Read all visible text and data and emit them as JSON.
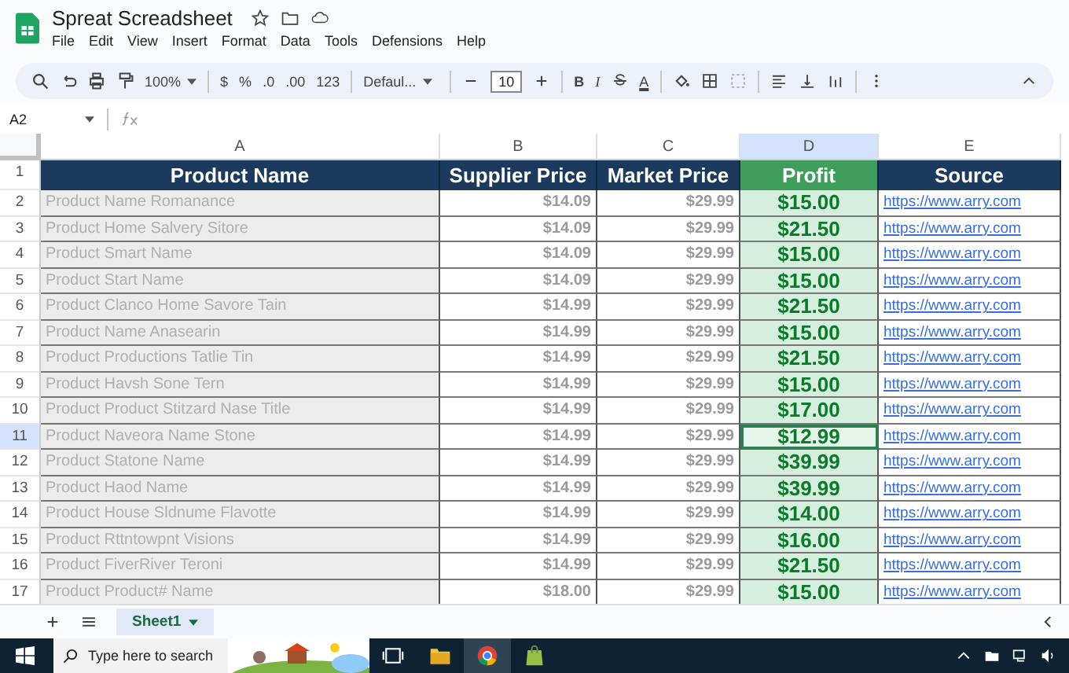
{
  "app": {
    "title": "Spreat Screadsheet",
    "menu": [
      "File",
      "Edit",
      "View",
      "Insert",
      "Format",
      "Data",
      "Tools",
      "Defensions",
      "Help"
    ]
  },
  "toolbar": {
    "zoom": "100%",
    "currency": "$",
    "percent": "%",
    "decrease_decimal": ".0",
    "increase_decimal": ".00",
    "number_format": "123",
    "font": "Defaul...",
    "font_size": "10",
    "bold": "B",
    "italic": "I",
    "text_color": "A"
  },
  "formula_bar": {
    "cell_ref": "A2"
  },
  "columns": [
    {
      "letter": "A",
      "selected": false
    },
    {
      "letter": "B",
      "selected": false
    },
    {
      "letter": "C",
      "selected": false
    },
    {
      "letter": "D",
      "selected": true
    },
    {
      "letter": "E",
      "selected": false
    }
  ],
  "header_row_number": "1",
  "header": [
    "Product Name",
    "Supplier Price",
    "Market Price",
    "Profit",
    "Source"
  ],
  "rows": [
    {
      "number": "2",
      "name": "Product Name Romanance",
      "supplier": "$14.09",
      "market": "$29.99",
      "profit": "$15.00",
      "source": "https://www.arry.com",
      "selected": false
    },
    {
      "number": "3",
      "name": "Product Home Salvery Sitore",
      "supplier": "$14.09",
      "market": "$29.99",
      "profit": "$21.50",
      "source": "https://www.arry.com",
      "selected": false
    },
    {
      "number": "4",
      "name": "Product Smart Name",
      "supplier": "$14.09",
      "market": "$29.99",
      "profit": "$15.00",
      "source": "https://www.arry.com",
      "selected": false
    },
    {
      "number": "5",
      "name": "Product Start Name",
      "supplier": "$14.09",
      "market": "$29.99",
      "profit": "$15.00",
      "source": "https://www.arry.com",
      "selected": false
    },
    {
      "number": "6",
      "name": "Product Clanco Home Savore Tain",
      "supplier": "$14.99",
      "market": "$29.99",
      "profit": "$21.50",
      "source": "https://www.arry.com",
      "selected": false
    },
    {
      "number": "7",
      "name": "Product Name Anasearin",
      "supplier": "$14.99",
      "market": "$29.99",
      "profit": "$15.00",
      "source": "https://www.arry.com",
      "selected": false
    },
    {
      "number": "8",
      "name": "Product Productions Tatlie Tin",
      "supplier": "$14.99",
      "market": "$29.99",
      "profit": "$21.50",
      "source": "https://www.arry.com",
      "selected": false
    },
    {
      "number": "9",
      "name": "Product Havsh Sone Tern",
      "supplier": "$14.99",
      "market": "$29.99",
      "profit": "$15.00",
      "source": "https://www.arry.com",
      "selected": false
    },
    {
      "number": "10",
      "name": "Product Product Stitzard Nase Title",
      "supplier": "$14.99",
      "market": "$29.99",
      "profit": "$17.00",
      "source": "https://www.arry.com",
      "selected": false
    },
    {
      "number": "11",
      "name": "Product Naveora Name Stone",
      "supplier": "$14.99",
      "market": "$29.99",
      "profit": "$12.99",
      "source": "https://www.arry.com",
      "selected": true
    },
    {
      "number": "12",
      "name": "Product Statone Name",
      "supplier": "$14.99",
      "market": "$29.99",
      "profit": "$39.99",
      "source": "https://www.arry.com",
      "selected": false
    },
    {
      "number": "13",
      "name": "Product Haod Name",
      "supplier": "$14.99",
      "market": "$29.99",
      "profit": "$39.99",
      "source": "https://www.arry.com",
      "selected": false
    },
    {
      "number": "14",
      "name": "Product House Sldnume Flavotte",
      "supplier": "$14.99",
      "market": "$29.99",
      "profit": "$14.00",
      "source": "https://www.arry.com",
      "selected": false
    },
    {
      "number": "15",
      "name": "Product Rttntowpnt Visions",
      "supplier": "$14.99",
      "market": "$29.99",
      "profit": "$16.00",
      "source": "https://www.arry.com",
      "selected": false
    },
    {
      "number": "16",
      "name": "Product FiverRiver Teroni",
      "supplier": "$14.99",
      "market": "$29.99",
      "profit": "$21.50",
      "source": "https://www.arry.com",
      "selected": false
    },
    {
      "number": "17",
      "name": "Product Product# Name",
      "supplier": "$18.00",
      "market": "$29.99",
      "profit": "$15.00",
      "source": "https://www.arry.com",
      "selected": false
    }
  ],
  "sheets": [
    {
      "label": "Sheet1",
      "selected": true
    }
  ],
  "taskbar": {
    "search_placeholder": "Type here to search"
  }
}
